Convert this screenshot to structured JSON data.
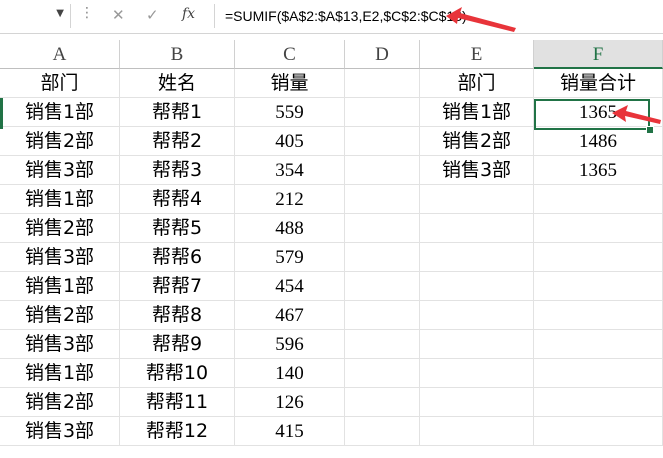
{
  "formula_bar": {
    "cancel_icon": "✕",
    "enter_icon": "✓",
    "fx_label": "fx",
    "formula": "=SUMIF($A$2:$A$13,E2,$C$2:$C$13)"
  },
  "columns": [
    "A",
    "B",
    "C",
    "D",
    "E",
    "F"
  ],
  "selected_column": "F",
  "table1": {
    "headers": [
      "部门",
      "姓名",
      "销量"
    ],
    "rows": [
      [
        "销售1部",
        "帮帮1",
        "559"
      ],
      [
        "销售2部",
        "帮帮2",
        "405"
      ],
      [
        "销售3部",
        "帮帮3",
        "354"
      ],
      [
        "销售1部",
        "帮帮4",
        "212"
      ],
      [
        "销售2部",
        "帮帮5",
        "488"
      ],
      [
        "销售3部",
        "帮帮6",
        "579"
      ],
      [
        "销售1部",
        "帮帮7",
        "454"
      ],
      [
        "销售2部",
        "帮帮8",
        "467"
      ],
      [
        "销售3部",
        "帮帮9",
        "596"
      ],
      [
        "销售1部",
        "帮帮10",
        "140"
      ],
      [
        "销售2部",
        "帮帮11",
        "126"
      ],
      [
        "销售3部",
        "帮帮12",
        "415"
      ]
    ]
  },
  "table2": {
    "headers": [
      "部门",
      "销量合计"
    ],
    "rows": [
      [
        "销售1部",
        "1365"
      ],
      [
        "销售2部",
        "1486"
      ],
      [
        "销售3部",
        "1365"
      ]
    ]
  },
  "colors": {
    "accent": "#217346",
    "annotation": "#e8343a"
  }
}
